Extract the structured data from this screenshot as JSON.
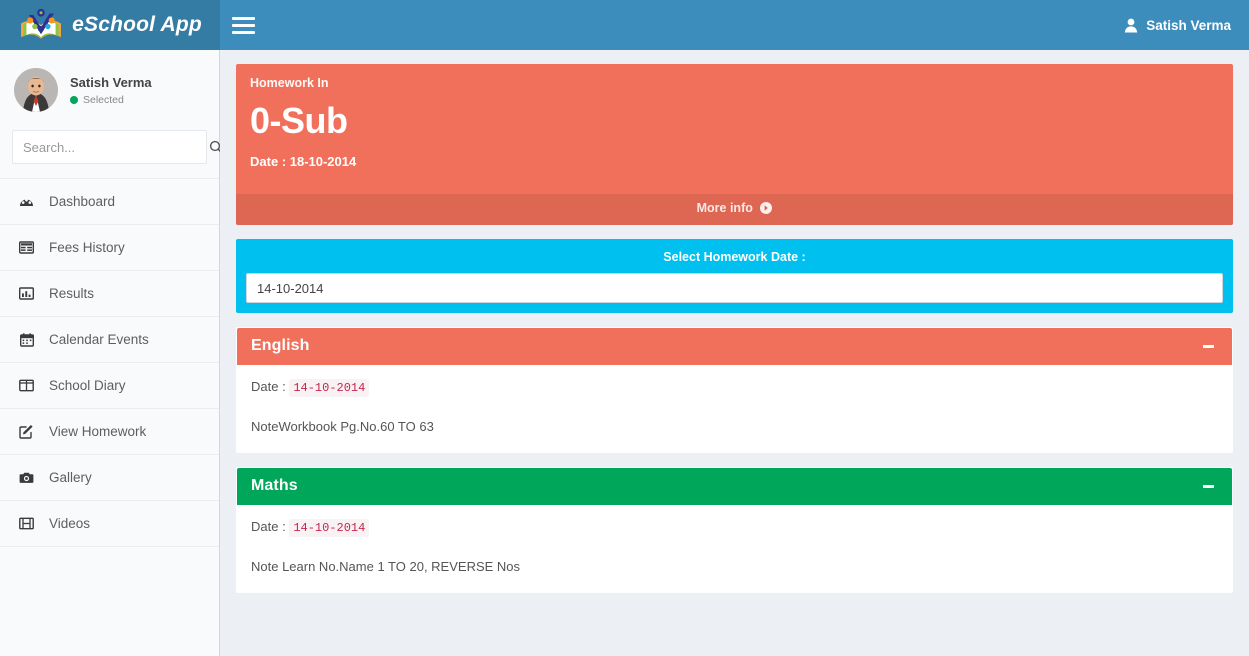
{
  "header": {
    "brand": "eSchool App",
    "logo_icon": "open-book-logo",
    "menu_toggle_icon": "hamburger-icon",
    "user_icon": "user-icon",
    "user_name": "Satish Verma",
    "brand_bg": "#357ca5",
    "navbar_bg": "#3c8dbc"
  },
  "sidebar": {
    "profile": {
      "avatar_icon": "user-avatar",
      "name": "Satish Verma",
      "status": "Selected",
      "status_color": "#00a65a"
    },
    "search": {
      "placeholder": "Search...",
      "value": "",
      "button_icon": "search-icon"
    },
    "items": [
      {
        "label": "Dashboard",
        "icon": "dashboard-icon"
      },
      {
        "label": "Fees History",
        "icon": "table-icon"
      },
      {
        "label": "Results",
        "icon": "bar-chart-icon"
      },
      {
        "label": "Calendar Events",
        "icon": "calendar-icon"
      },
      {
        "label": "School Diary",
        "icon": "columns-icon"
      },
      {
        "label": "View Homework",
        "icon": "edit-square-icon"
      },
      {
        "label": "Gallery",
        "icon": "camera-icon"
      },
      {
        "label": "Videos",
        "icon": "film-icon"
      }
    ]
  },
  "main": {
    "info_card": {
      "label": "Homework In",
      "value": "0-Sub",
      "date": "Date : 18-10-2014",
      "footer_label": "More info",
      "footer_icon": "circle-arrow-right-icon",
      "bg": "#f1705b"
    },
    "date_selector": {
      "title": "Select Homework Date :",
      "value": "14-10-2014",
      "bg": "#00c0ef"
    },
    "subjects": [
      {
        "title": "English",
        "color": "#f1705b",
        "collapse_icon": "minus-icon",
        "date_label": "Date :",
        "date_value": "14-10-2014",
        "note": "NoteWorkbook Pg.No.60 TO 63"
      },
      {
        "title": "Maths",
        "color": "#00a65a",
        "collapse_icon": "minus-icon",
        "date_label": "Date :",
        "date_value": "14-10-2014",
        "note": "Note Learn No.Name 1 TO 20, REVERSE Nos"
      }
    ]
  }
}
